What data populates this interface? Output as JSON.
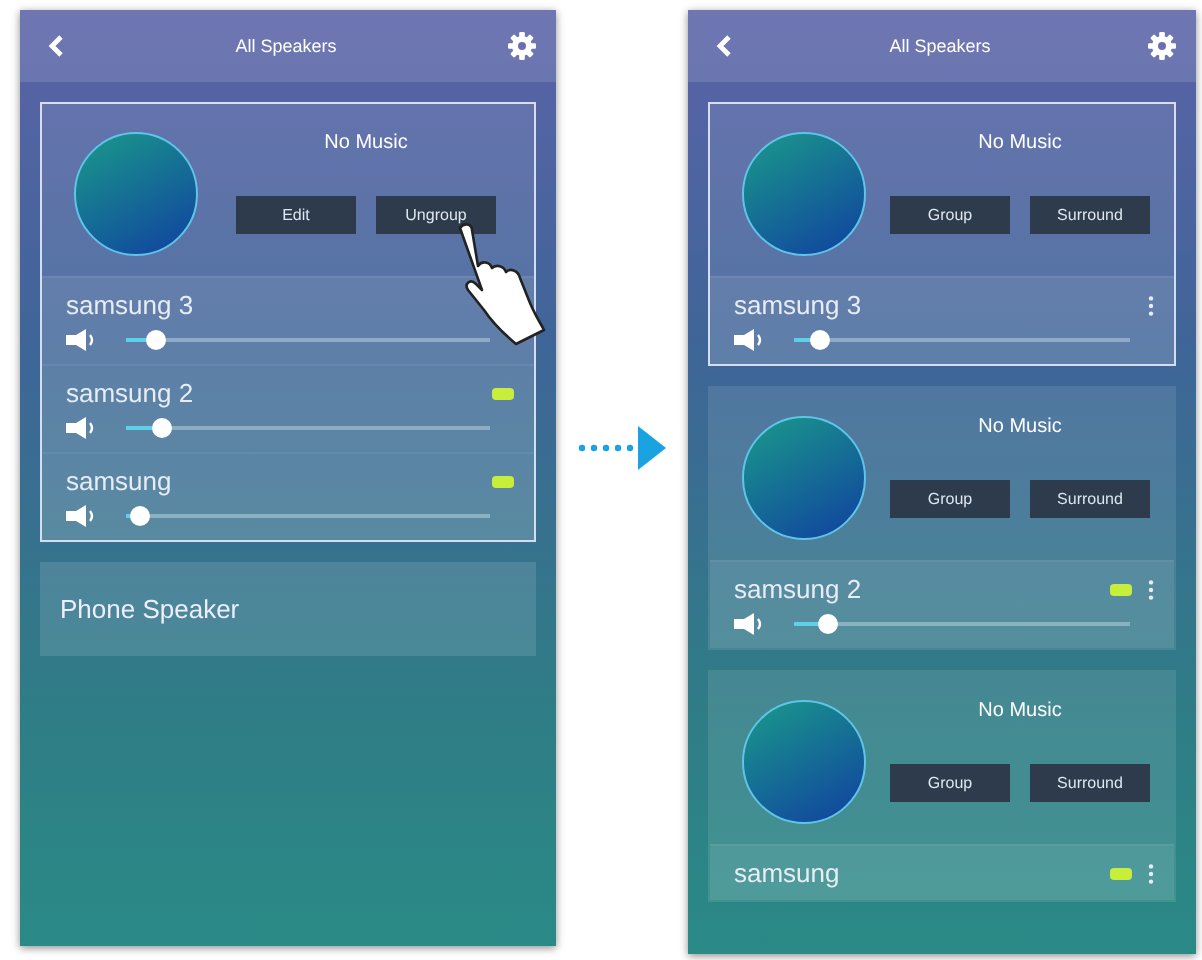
{
  "screens": [
    {
      "title": "All Speakers",
      "groups": [
        {
          "framed": true,
          "status": "No Music",
          "buttons": [
            {
              "label": "Edit",
              "touched": false
            },
            {
              "label": "Ungroup",
              "touched": true
            }
          ],
          "speakers": [
            {
              "name": "samsung 3",
              "battery": false,
              "menu": false,
              "level": 0.08
            },
            {
              "name": "samsung 2",
              "battery": true,
              "menu": false,
              "level": 0.1
            },
            {
              "name": "samsung",
              "battery": true,
              "menu": false,
              "level": 0.04
            }
          ]
        }
      ],
      "phone_speaker": "Phone Speaker"
    },
    {
      "title": "All Speakers",
      "groups": [
        {
          "framed": true,
          "status": "No Music",
          "buttons": [
            {
              "label": "Group",
              "touched": false
            },
            {
              "label": "Surround",
              "touched": false
            }
          ],
          "speakers": [
            {
              "name": "samsung 3",
              "battery": false,
              "menu": true,
              "level": 0.08
            }
          ]
        },
        {
          "framed": false,
          "status": "No Music",
          "buttons": [
            {
              "label": "Group",
              "touched": false
            },
            {
              "label": "Surround",
              "touched": false
            }
          ],
          "speakers": [
            {
              "name": "samsung 2",
              "battery": true,
              "menu": true,
              "level": 0.1
            }
          ]
        },
        {
          "framed": false,
          "status": "No Music",
          "buttons": [
            {
              "label": "Group",
              "touched": false
            },
            {
              "label": "Surround",
              "touched": false
            }
          ],
          "speakers": [
            {
              "name": "samsung",
              "battery": true,
              "menu": true
            }
          ]
        }
      ]
    }
  ]
}
